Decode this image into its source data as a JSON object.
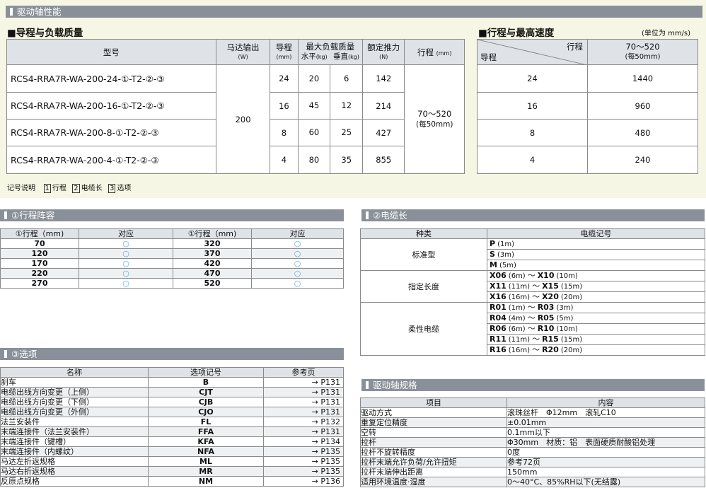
{
  "header": {
    "title": "驱动轴性能"
  },
  "left_table": {
    "title": "■导程与负载质量",
    "headers": {
      "model": "型号",
      "motor": "马达输出",
      "motor_unit": "(W)",
      "lead": "导程",
      "lead_unit": "(mm)",
      "maxload": "最大负载质量",
      "horizontal": "水平",
      "h_unit": "(kg)",
      "vertical": "垂直",
      "v_unit": "(kg)",
      "thrust": "额定推力",
      "thrust_unit": "(N)",
      "stroke": "行程",
      "stroke_unit": "(mm)"
    },
    "motor_value": "200",
    "stroke_value": "70～520",
    "stroke_note": "(每50mm)",
    "rows": [
      {
        "model": "RCS4-RRA7R-WA-200-24-①-T2-②-③",
        "lead": "24",
        "h": "20",
        "v": "6",
        "thrust": "142"
      },
      {
        "model": "RCS4-RRA7R-WA-200-16-①-T2-②-③",
        "lead": "16",
        "h": "45",
        "v": "12",
        "thrust": "214"
      },
      {
        "model": "RCS4-RRA7R-WA-200-8-①-T2-②-③",
        "lead": "8",
        "h": "60",
        "v": "25",
        "thrust": "427"
      },
      {
        "model": "RCS4-RRA7R-WA-200-4-①-T2-②-③",
        "lead": "4",
        "h": "80",
        "v": "35",
        "thrust": "855"
      }
    ]
  },
  "legend": {
    "label": "记号说明",
    "items": [
      {
        "num": "1",
        "text": "行程"
      },
      {
        "num": "2",
        "text": "电缆长"
      },
      {
        "num": "3",
        "text": "选项"
      }
    ]
  },
  "right_table": {
    "title": "■行程与最高速度",
    "unit": "(单位为 mm/s)",
    "corner_top": "行程",
    "corner_bottom": "导程",
    "stroke": "70～520",
    "stroke_note": "(每50mm)",
    "rows": [
      {
        "lead": "24",
        "speed": "1440"
      },
      {
        "lead": "16",
        "speed": "960"
      },
      {
        "lead": "8",
        "speed": "480"
      },
      {
        "lead": "4",
        "speed": "240"
      }
    ]
  },
  "stroke_section": {
    "title": "①行程阵容",
    "headers": [
      "①行程（mm)",
      "对应",
      "①行程（mm)",
      "对应"
    ],
    "rows": [
      [
        "70",
        "○",
        "320",
        "○"
      ],
      [
        "120",
        "○",
        "370",
        "○"
      ],
      [
        "170",
        "○",
        "420",
        "○"
      ],
      [
        "220",
        "○",
        "470",
        "○"
      ],
      [
        "270",
        "○",
        "520",
        "○"
      ]
    ]
  },
  "cable_section": {
    "title": "②电缆长",
    "headers": [
      "种类",
      "电缆记号"
    ],
    "groups": [
      {
        "type": "标准型",
        "items": [
          {
            "code": "P",
            "len": "(1m)"
          },
          {
            "code": "S",
            "len": "(3m)"
          },
          {
            "code": "M",
            "len": "(5m)"
          }
        ]
      },
      {
        "type": "指定长度",
        "items": [
          {
            "code": "X06",
            "len": "(6m)",
            "code2": "X10",
            "len2": "(10m)"
          },
          {
            "code": "X11",
            "len": "(11m)",
            "code2": "X15",
            "len2": "(15m)"
          },
          {
            "code": "X16",
            "len": "(16m)",
            "code2": "X20",
            "len2": "(20m)"
          }
        ]
      },
      {
        "type": "柔性电缆",
        "items": [
          {
            "code": "R01",
            "len": "(1m)",
            "code2": "R03",
            "len2": "(3m)"
          },
          {
            "code": "R04",
            "len": "(4m)",
            "code2": "R05",
            "len2": "(5m)"
          },
          {
            "code": "R06",
            "len": "(6m)",
            "code2": "R10",
            "len2": "(10m)"
          },
          {
            "code": "R11",
            "len": "(11m)",
            "code2": "R15",
            "len2": "(15m)"
          },
          {
            "code": "R16",
            "len": "(16m)",
            "code2": "R20",
            "len2": "(20m)"
          }
        ]
      }
    ],
    "tilde": "～"
  },
  "option_section": {
    "title": "③选项",
    "headers": [
      "名称",
      "选项记号",
      "参考页"
    ],
    "rows": [
      [
        "刹车",
        "B",
        "→ P131"
      ],
      [
        "电缆出线方向变更（上侧）",
        "CJT",
        "→ P131"
      ],
      [
        "电缆出线方向变更（下侧）",
        "CJB",
        "→ P131"
      ],
      [
        "电缆出线方向变更（外侧）",
        "CJO",
        "→ P131"
      ],
      [
        "法兰安装件",
        "FL",
        "→ P132"
      ],
      [
        "末端连接件（法兰安装件）",
        "FFA",
        "→ P131"
      ],
      [
        "末端连接件（键槽）",
        "KFA",
        "→ P134"
      ],
      [
        "末端连接件（内螺纹）",
        "NFA",
        "→ P135"
      ],
      [
        "马达左折返规格",
        "ML",
        "→ P135"
      ],
      [
        "马达右折返规格",
        "MR",
        "→ P135"
      ],
      [
        "反原点规格",
        "NM",
        "→ P136"
      ]
    ]
  },
  "spec_section": {
    "title": "驱动轴规格",
    "headers": [
      "项目",
      "内容"
    ],
    "rows": [
      [
        "驱动方式",
        "滚珠丝杆　Φ12mm　滚轧C10"
      ],
      [
        "重复定位精度",
        "±0.01mm"
      ],
      [
        "空转",
        "0.1mm以下"
      ],
      [
        "拉杆",
        "Φ30mm　材质：铝　表面硬质耐酸铝处理"
      ],
      [
        "拉杆不旋转精度",
        "0度"
      ],
      [
        "拉杆末端允许负荷/允许扭矩",
        "参考72页"
      ],
      [
        "拉杆末端伸出距离",
        "150mm"
      ],
      [
        "适用环境温度·湿度",
        "0～40°C、85%RH以下(无结露)"
      ]
    ]
  }
}
